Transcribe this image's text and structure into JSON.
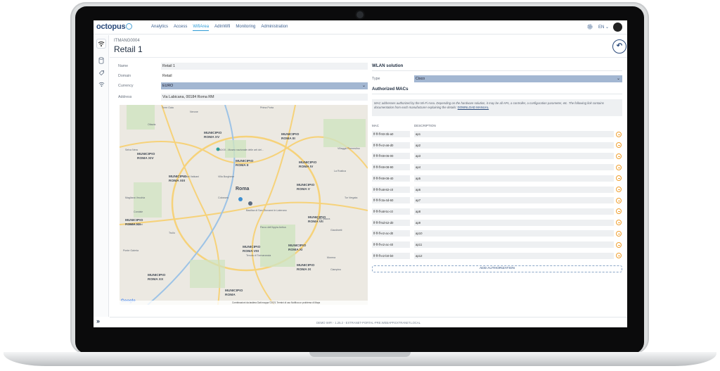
{
  "app": {
    "logo": "octopus"
  },
  "nav": [
    "Analytics",
    "Access",
    "WifiArea",
    "AdInWifi",
    "Monitoring",
    "Administration"
  ],
  "nav_active": "WifiArea",
  "lang": "EN",
  "header": {
    "code": "ITMANG0004",
    "title": "Retail 1"
  },
  "form": {
    "name_label": "Name",
    "name_value": "Retail 1",
    "domain_label": "Domain",
    "domain_value": "Retail",
    "currency_label": "Currency",
    "currency_value": "EURO",
    "address_label": "Address",
    "address_value": "Via Labicana, 00184 Roma RM"
  },
  "map": {
    "labels": [
      {
        "t": "MUNICIPIO\nROMA XV"
      },
      {
        "t": "MUNICIPIO\nROMA III"
      },
      {
        "t": "MUNICIPIO\nROMA XIV"
      },
      {
        "t": "MUNICIPIO\nROMA II"
      },
      {
        "t": "MUNICIPIO\nROMA IV"
      },
      {
        "t": "MUNICIPIO\nROMA XIII"
      },
      {
        "t": "Roma"
      },
      {
        "t": "MUNICIPIO\nROMA V"
      },
      {
        "t": "MUNICIPIO\nROMA XII"
      },
      {
        "t": "MUNICIPIO\nROMA VII"
      },
      {
        "t": "MUNICIPIO\nROMA VIII"
      },
      {
        "t": "MUNICIPIO\nROMA XI"
      },
      {
        "t": "MUNICIPIO\nROMA IX"
      },
      {
        "t": "MUNICIPIO\nROMA XX"
      },
      {
        "t": "MUNICIPIO\nROMA"
      }
    ],
    "places": [
      "Torre Gaia",
      "Prima Porta",
      "Nerone",
      "Ottavia",
      "Selva Nera",
      "Musei Vaticani",
      "Villa Borghese",
      "MAXXI - Museo nazionale delle arti del...",
      "Colosseo",
      "Basilica di San Giovanni in Laterano",
      "Parco dell'Appia Antica",
      "Tenuta di Tormarancia",
      "Magliana Vecchia",
      "Corviale",
      "Casetta Mattei",
      "Trullo",
      "Villaggio Prenestino",
      "La Rustica",
      "Torre Maura",
      "Giardinetti",
      "Morena",
      "Ciampino",
      "Tor Vergata",
      "Ponte Galeria"
    ],
    "footer": "Combinazioni da tastiera   Dati mappa ©2021   Termini di uso   Notifica un problema di Maps",
    "google": "Google"
  },
  "wlan": {
    "title": "WLAN solution",
    "type_label": "Type",
    "type_value": "Cisco",
    "auth_title": "Authorized MACs",
    "description": "MAC addresses authorized by the Wi-Fi Area. Depending on the hardware solution, it may be all APs, a controller, a configuration parameter, etc. The following link contains documentation from each manufacturer explaining the details:",
    "link": "DOWNLOAD MANUAL",
    "col_mac": "MAC",
    "col_desc": "DESCRIPTION",
    "rows": [
      {
        "mac": "ff-ff-ff-93-3b-a0",
        "desc": "ap1"
      },
      {
        "mac": "ff-ff-ff-e2-a6-d0",
        "desc": "ap2"
      },
      {
        "mac": "ff-ff-ff-69-06-00",
        "desc": "ap3"
      },
      {
        "mac": "ff-ff-ff-69-08-90",
        "desc": "ap4"
      },
      {
        "mac": "ff-ff-ff-69-08-40",
        "desc": "ap5"
      },
      {
        "mac": "ff-ff-ff-a8-82-c0",
        "desc": "ap6"
      },
      {
        "mac": "ff-ff-ff-3a-4d-60",
        "desc": "ap7"
      },
      {
        "mac": "ff-ff-ff-a8-5c-c0",
        "desc": "ap8"
      },
      {
        "mac": "ff-ff-ff-5d-52-d0",
        "desc": "ap9"
      },
      {
        "mac": "ff-ff-ff-e2-ac-d0",
        "desc": "ap10"
      },
      {
        "mac": "ff-ff-ff-e2-ac-40",
        "desc": "ap11"
      },
      {
        "mac": "ff-ff-ff-e2-b0-b0",
        "desc": "ap12"
      }
    ],
    "add_label": "ADD AUTHORIZATION"
  },
  "footer": "DEMO WIFI - 1.25.2 - EXTRANET-PORTAL-PRE.WEBAPP.EXTRANET.LOCAL",
  "colors": {
    "accent": "#2e9bd6",
    "brand": "#2a4a7b",
    "select": "#a3b7d2",
    "remove": "#f0a030"
  }
}
